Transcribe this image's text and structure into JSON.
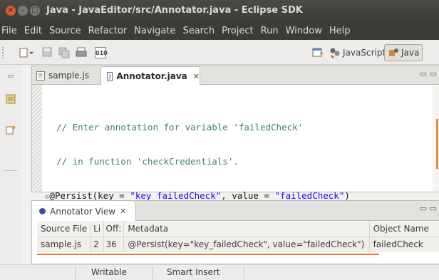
{
  "window": {
    "title": "Java - JavaEditor/src/Annotator.java - Eclipse SDK",
    "controls": {
      "close": "×",
      "minimize": "–",
      "maximize": "□"
    }
  },
  "menu": [
    "File",
    "Edit",
    "Source",
    "Refactor",
    "Navigate",
    "Search",
    "Project",
    "Run",
    "Window",
    "Help"
  ],
  "toolbar": {
    "icons": [
      "new-wizard-icon",
      "save-icon",
      "save-all-icon",
      "print-icon",
      "binary-icon"
    ],
    "binary_glyph": "010",
    "perspectives": [
      {
        "label": "JavaScript",
        "active": false,
        "icon": "javascript-perspective-icon"
      },
      {
        "label": "Java",
        "active": true,
        "icon": "java-perspective-icon"
      }
    ]
  },
  "editor": {
    "tabs": [
      {
        "label": "sample.js",
        "active": false,
        "icon": "js-file-icon"
      },
      {
        "label": "Annotator.java",
        "active": true,
        "icon": "java-file-icon",
        "close": "✕"
      }
    ],
    "minmax": "▭ ▭",
    "code": {
      "line1": "// Enter annotation for variable 'failedCheck'",
      "line2": "// in function 'checkCredentials'.",
      "line3_prefix": "@Persist(key = ",
      "line3_key": "\"key_failedCheck\"",
      "line3_mid": ", value = ",
      "line3_value": "\"failedCheck\"",
      "line3_suffix": ")"
    }
  },
  "annotator_view": {
    "tab_label": "Annotator View",
    "tab_close": "✕",
    "minmax": "▭ ▭",
    "columns": [
      "Source File",
      "Li",
      "Off:",
      "Metadata",
      "Object Name"
    ],
    "rows": [
      [
        "sample.js",
        "2",
        "36",
        "@Persist(key=\"key_failedCheck\", value=\"failedCheck\")",
        "failedCheck"
      ]
    ]
  },
  "status": {
    "mode": "Writable",
    "insert": "Smart Insert"
  },
  "colors": {
    "comment": "#3f7f5f",
    "string": "#2a00ff",
    "accent": "#e27a3a",
    "titlebar": "#3c3b37"
  }
}
